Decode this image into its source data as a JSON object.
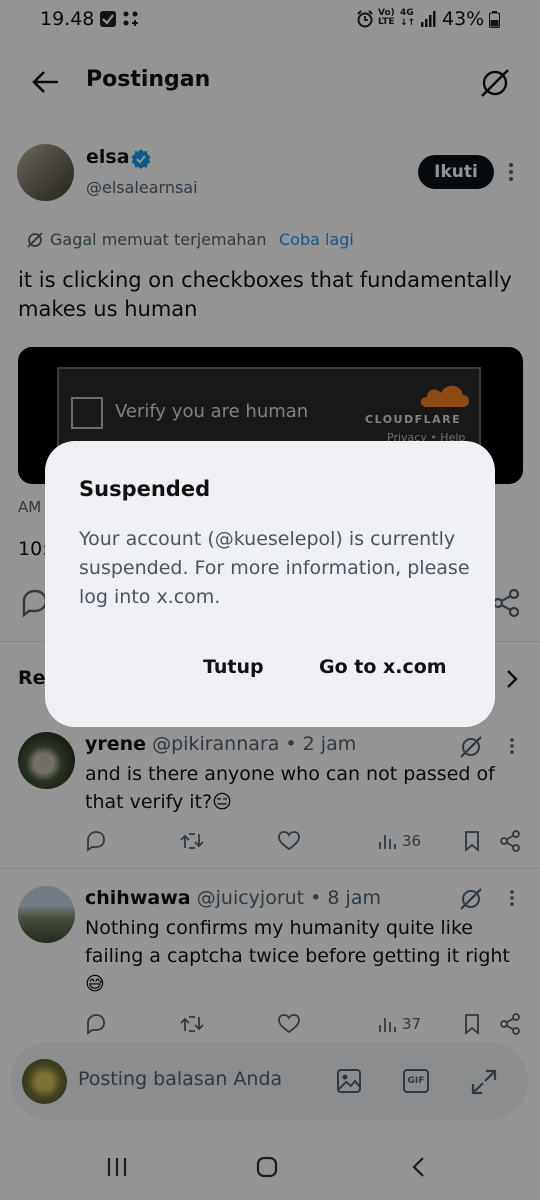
{
  "status_bar": {
    "time": "19.48",
    "battery": "43%",
    "network": "4G"
  },
  "header": {
    "title": "Postingan"
  },
  "post": {
    "author_name": "elsa",
    "author_handle": "@elsalearnsai",
    "follow_label": "Ikuti",
    "translation_failed": "Gagal memuat terjemahan",
    "retry_label": "Coba lagi",
    "text": "it is clicking on checkboxes that fundamentally makes us human",
    "captcha": {
      "label": "Verify you are human",
      "brand": "CLOUDFLARE",
      "links": "Privacy • Help"
    },
    "time_prefix": "AM",
    "time_partial": "10:"
  },
  "section": {
    "label_partial": "Re"
  },
  "replies": [
    {
      "name": "yrene",
      "handle": "@pikirannara",
      "time": "• 2 jam",
      "text": "and is there anyone who can not passed of that verify it?😑",
      "views": "36"
    },
    {
      "name": "chihwawa",
      "handle": "@juicyjorut",
      "time": "• 8 jam",
      "text": "Nothing confirms my humanity quite like failing a captcha twice before getting it right 😅",
      "views": "37"
    }
  ],
  "composer": {
    "placeholder": "Posting balasan Anda",
    "gif_label": "GIF"
  },
  "dialog": {
    "title": "Suspended",
    "body": "Your account (@kueselepol) is currently suspended. For more information, please log into x.com.",
    "close_label": "Tutup",
    "goto_label": "Go to x.com"
  },
  "colors": {
    "accent": "#1d9bf0",
    "dialog_bg": "#eef0f3"
  }
}
